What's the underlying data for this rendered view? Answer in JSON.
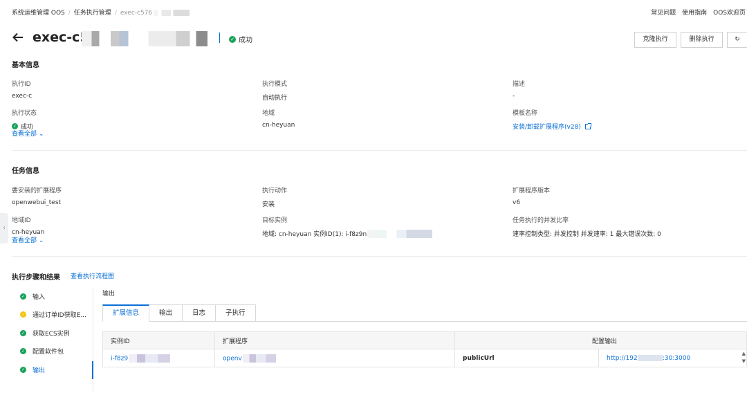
{
  "breadcrumb": {
    "root": "系统运维管理 OOS",
    "parent": "任务执行管理",
    "current": "exec-c576"
  },
  "top_links": {
    "faq": "常见问题",
    "guide": "使用指南",
    "welcome": "OOS欢迎页"
  },
  "header": {
    "title": "exec-c5",
    "status": "成功",
    "clone_button": "克隆执行",
    "delete_button": "删除执行",
    "refresh_glyph": "↻"
  },
  "basic_info": {
    "title": "基本信息",
    "exec_id_label": "执行ID",
    "exec_id_value": "exec-c",
    "mode_label": "执行模式",
    "mode_value": "自动执行",
    "desc_label": "描述",
    "desc_value": "-",
    "status_label": "执行状态",
    "status_value": "成功",
    "region_label": "地域",
    "region_value": "cn-heyuan",
    "template_label": "模板名称",
    "template_value": "安装/卸载扩展程序(v28)",
    "expand": "查看全部"
  },
  "task_info": {
    "title": "任务信息",
    "ext_label": "要安装的扩展程序",
    "ext_value": "openwebui_test",
    "action_label": "执行动作",
    "action_value": "安装",
    "version_label": "扩展程序版本",
    "version_value": "v6",
    "region_id_label": "地域ID",
    "region_id_value": "cn-heyuan",
    "target_label": "目标实例",
    "target_value": "地域: cn-heyuan 实例ID(1): i-f8z9n",
    "concurrency_label": "任务执行的并发比率",
    "concurrency_value": "速率控制类型: 并发控制 并发速率: 1 最大错误次数: 0",
    "expand": "查看全部"
  },
  "steps": {
    "title": "执行步骤和结果",
    "flow_link": "查看执行流程图",
    "items": [
      {
        "label": "输入",
        "status": "success"
      },
      {
        "label": "通过订单ID获取E...",
        "status": "warning"
      },
      {
        "label": "获取ECS实例",
        "status": "success"
      },
      {
        "label": "配置软件包",
        "status": "success"
      },
      {
        "label": "输出",
        "status": "success"
      }
    ]
  },
  "output": {
    "title": "输出",
    "tabs": [
      "扩展信息",
      "输出",
      "日志",
      "子执行"
    ],
    "columns": {
      "instance": "实例ID",
      "extension": "扩展程序",
      "config": "配置输出"
    },
    "row": {
      "instance": "i-f8z9",
      "extension": "openv",
      "key": "publicUrl",
      "url_prefix": "http://192",
      "url_suffix": ":30:3000"
    }
  },
  "colors": {
    "accent": "#0a6fd6",
    "success": "#1ba25a",
    "warning": "#f5c518"
  }
}
